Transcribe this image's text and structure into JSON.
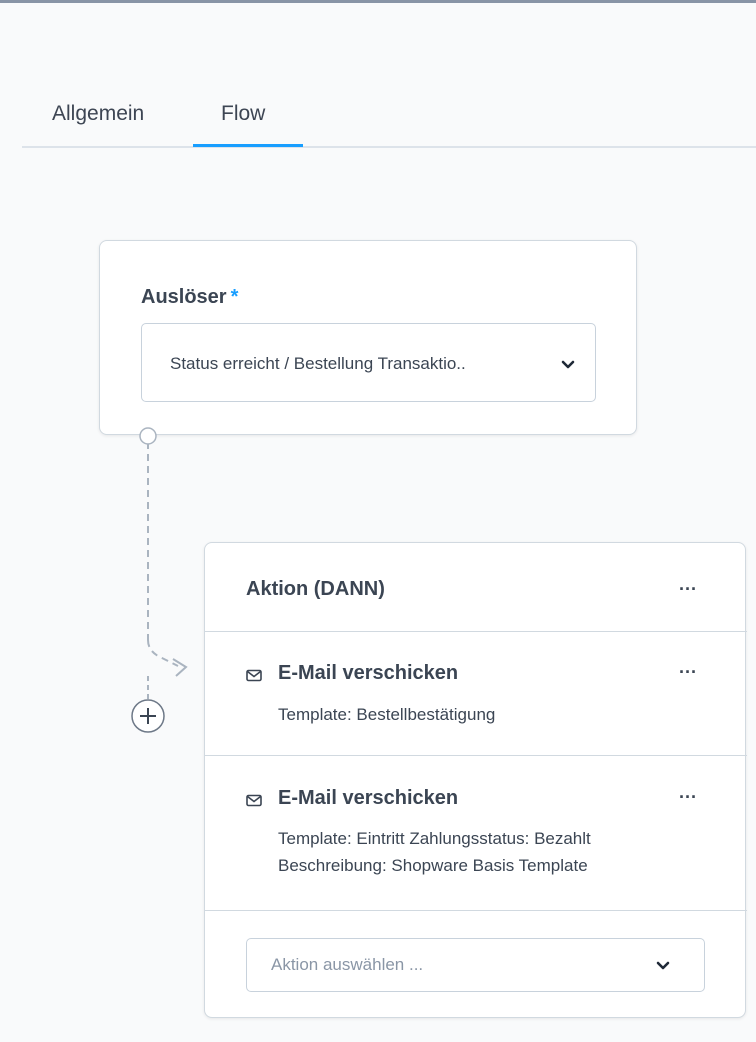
{
  "tabs": [
    {
      "label": "Allgemein",
      "active": false
    },
    {
      "label": "Flow",
      "active": true
    }
  ],
  "trigger": {
    "label": "Auslöser",
    "required_mark": "*",
    "value": "Status erreicht / Bestellung Transaktio.."
  },
  "action_block": {
    "title": "Aktion (DANN)",
    "menu_label": "···",
    "items": [
      {
        "icon": "mail-icon",
        "title": "E-Mail verschicken",
        "lines": [
          "Template: Bestellbestätigung"
        ]
      },
      {
        "icon": "mail-icon",
        "title": "E-Mail verschicken",
        "lines": [
          "Template: Eintritt Zahlungsstatus: Bezahlt",
          "Beschreibung: Shopware Basis Template"
        ]
      }
    ],
    "select_placeholder": "Aktion auswählen ..."
  },
  "colors": {
    "accent": "#189eff",
    "text": "#3b4553",
    "border": "#d1d9e0",
    "background": "#f9fafb"
  }
}
